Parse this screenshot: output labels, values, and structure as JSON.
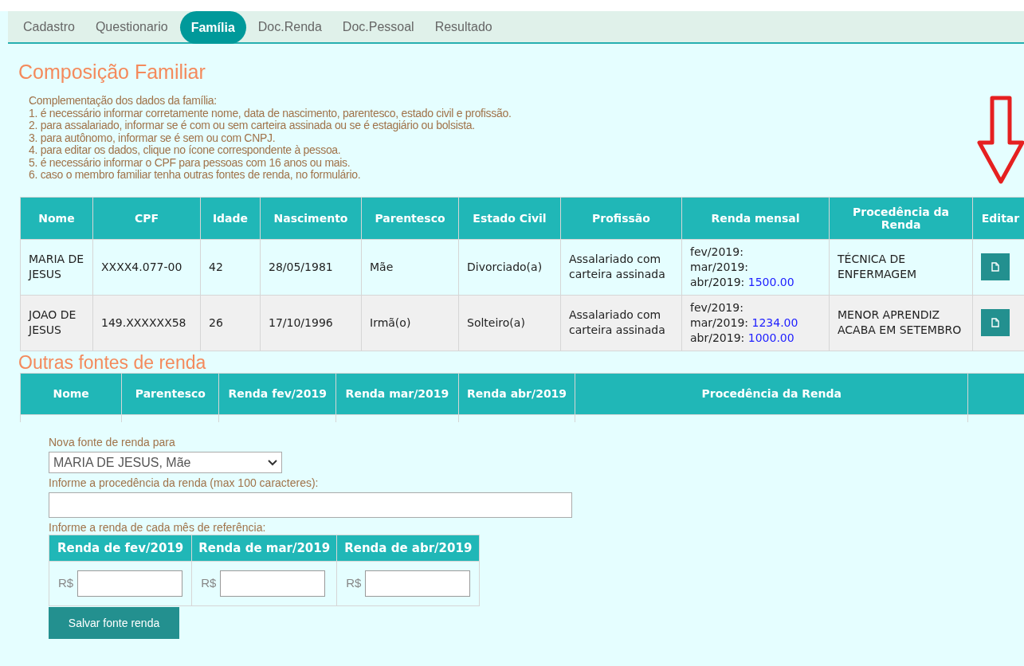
{
  "tabs": [
    {
      "label": "Cadastro",
      "selected": false
    },
    {
      "label": "Questionario",
      "selected": false
    },
    {
      "label": "Família",
      "selected": true
    },
    {
      "label": "Doc.Renda",
      "selected": false
    },
    {
      "label": "Doc.Pessoal",
      "selected": false
    },
    {
      "label": "Resultado",
      "selected": false
    }
  ],
  "family": {
    "title": "Composição Familiar",
    "instructions": [
      "Complementação dos dados da família:",
      "1. é necessário informar corretamente nome, data de nascimento, parentesco, estado civil e profissão.",
      "2. para assalariado, informar se é com ou sem carteira assinada ou se é estagiário ou bolsista.",
      "3. para autônomo, informar se é sem ou com CNPJ.",
      "4. para editar os dados, clique no ícone correspondente à pessoa.",
      "5. é necessário informar o CPF para pessoas com 16 anos ou mais.",
      "6. caso o membro familiar tenha outras fontes de renda, no formulário."
    ],
    "columns": [
      "Nome",
      "CPF",
      "Idade",
      "Nascimento",
      "Parentesco",
      "Estado Civil",
      "Profissão",
      "Renda mensal",
      "Procedência da Renda",
      "Editar"
    ],
    "rows": [
      {
        "nome": "MARIA DE JESUS",
        "cpf": "XXXX4.077-00",
        "idade": "42",
        "nascimento": "28/05/1981",
        "parentesco": "Mãe",
        "estado_civil": "Divorciado(a)",
        "profissao": "Assalariado com carteira assinada",
        "renda": [
          {
            "label": "fev/2019:"
          },
          {
            "label": "mar/2019:"
          },
          {
            "label": "abr/2019:",
            "value": "1500.00"
          }
        ],
        "procedencia": "TÉCNICA DE ENFERMAGEM"
      },
      {
        "nome": "JOAO DE JESUS",
        "cpf": "149.XXXXXX58",
        "idade": "26",
        "nascimento": "17/10/1996",
        "parentesco": "Irmã(o)",
        "estado_civil": "Solteiro(a)",
        "profissao": "Assalariado com carteira assinada",
        "renda": [
          {
            "label": "fev/2019:"
          },
          {
            "label": "mar/2019:",
            "value": "1234.00"
          },
          {
            "label": "abr/2019:",
            "value": "1000.00"
          }
        ],
        "procedencia": "MENOR APRENDIZ ACABA EM SETEMBRO"
      }
    ]
  },
  "other": {
    "title": "Outras fontes de renda",
    "columns": [
      "Nome",
      "Parentesco",
      "Renda fev/2019",
      "Renda mar/2019",
      "Renda abr/2019",
      "Procedência da Renda"
    ]
  },
  "form": {
    "person_label": "Nova fonte de renda para",
    "person_value": "MARIA DE JESUS, Mãe",
    "source_label": "Informe a procedência da renda (max 100 caracteres):",
    "months_label": "Informe a renda de cada mês de referência:",
    "months": [
      {
        "label": "Renda de fev/2019",
        "currency": "R$"
      },
      {
        "label": "Renda de mar/2019",
        "currency": "R$"
      },
      {
        "label": "Renda de abr/2019",
        "currency": "R$"
      }
    ],
    "save": "Salvar fonte renda"
  }
}
